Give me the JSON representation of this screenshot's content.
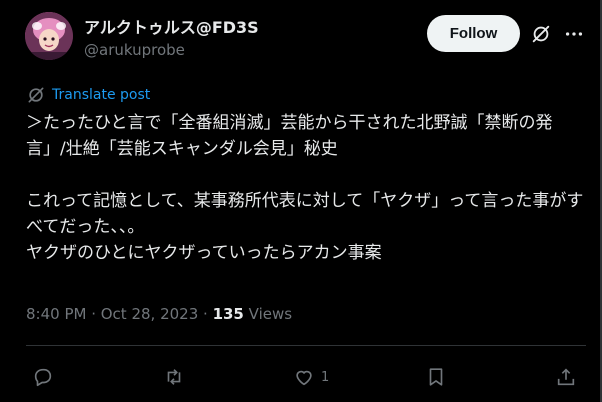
{
  "author": {
    "display_name": "アルクトゥルス@FD3S",
    "handle": "@arukuprobe"
  },
  "header": {
    "follow_label": "Follow"
  },
  "translate": {
    "label": "Translate post"
  },
  "post": {
    "lines": [
      "＞たったひと言で「全番組消滅」芸能から干された北野誠「禁断の発言」/壮絶「芸能スキャンダル会見」秘史",
      "これって記憶として、某事務所代表に対して「ヤクザ」って言った事がすべてだった、、。",
      "ヤクザのひとにヤクザっていったらアカン事案"
    ]
  },
  "meta": {
    "timestamp": "8:40 PM · Oct 28, 2023 · ",
    "views_count": "135",
    "views_label": " Views"
  },
  "actions": {
    "reply": {
      "icon": "reply-icon",
      "count": ""
    },
    "repost": {
      "icon": "repost-icon",
      "count": ""
    },
    "like": {
      "icon": "heart-icon",
      "count": "1"
    },
    "bookmark": {
      "icon": "bookmark-icon",
      "count": ""
    },
    "share": {
      "icon": "share-icon",
      "count": ""
    }
  },
  "colors": {
    "background": "#000000",
    "text": "#e7e9ea",
    "muted": "#71767b",
    "link": "#1d9bf0",
    "follow_bg": "#eff3f4"
  }
}
